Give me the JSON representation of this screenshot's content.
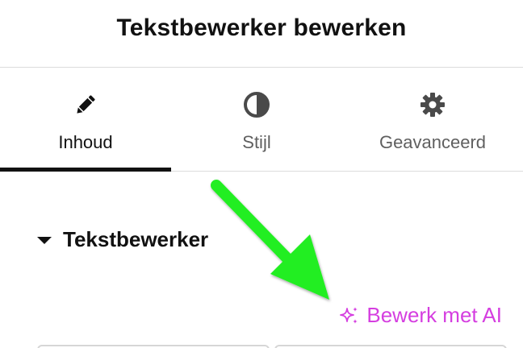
{
  "header": {
    "title": "Tekstbewerker bewerken"
  },
  "tabs": [
    {
      "label": "Inhoud",
      "icon": "pencil-icon",
      "active": true
    },
    {
      "label": "Stijl",
      "icon": "contrast-icon",
      "active": false
    },
    {
      "label": "Geavanceerd",
      "icon": "gear-icon",
      "active": false
    }
  ],
  "section": {
    "title": "Tekstbewerker",
    "expanded": true
  },
  "ai_link": {
    "label": "Bewerk met AI",
    "icon": "sparkle-icon",
    "color": "#d53ee0"
  },
  "annotation": {
    "arrow_color": "#22ee22"
  },
  "colors": {
    "active_tab_underline": "#111111",
    "inactive_tab_text": "#5f5f5f",
    "divider": "#dcdcdc"
  }
}
